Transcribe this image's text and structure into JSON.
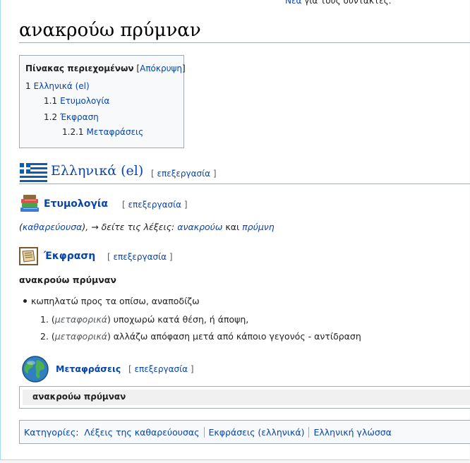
{
  "top_note": {
    "link": "Νέα",
    "rest": " για τους συντάκτες."
  },
  "page_title": "ανακρούω πρύμναν",
  "toc": {
    "title": "Πίνακας περιεχομένων",
    "toggle_open": "[",
    "toggle": "Απόκρυψη",
    "toggle_close": "]",
    "items": [
      {
        "num": "1",
        "label": "Ελληνικά (el)"
      },
      {
        "num": "1.1",
        "label": "Ετυμολογία"
      },
      {
        "num": "1.2",
        "label": "Έκφραση"
      },
      {
        "num": "1.2.1",
        "label": "Μεταφράσεις"
      }
    ]
  },
  "edit_label": "επεξεργασία",
  "sections": {
    "language": "Ελληνικά (el)",
    "etymology": "Ετυμολογία",
    "expression": "Έκφραση",
    "translations": "Μεταφράσεις"
  },
  "etymology": {
    "origin_link": "καθαρεύουσα",
    "text1": ", → δείτε τις λέξεις: ",
    "word1": "ανακρούω",
    "and": " και ",
    "word2": "πρύμνη"
  },
  "expression": {
    "headword": "ανακρούω πρύμναν",
    "definition": "κωπηλατώ προς τα οπίσω, αναποδίζω",
    "senses": [
      {
        "num": "1.",
        "label": "μεταφορικά",
        "text": " υποχωρώ κατά θέση, ή άποψη,"
      },
      {
        "num": "2.",
        "label": "μεταφορικά",
        "text": " αλλάζω απόφαση μετά από κάποιο γεγονός - αντίδραση"
      }
    ]
  },
  "translations_box": {
    "headword": "ανακρούω πρύμναν"
  },
  "categories": {
    "label": "Κατηγορίες",
    "items": [
      "Λέξεις της καθαρεύουσας",
      "Εκφράσεις (ελληνικά)",
      "Ελληνική γλώσσα"
    ]
  },
  "colors": {
    "link": "#0645ad",
    "rule": "#a2a9b1",
    "frame": "#a7d7f9"
  }
}
